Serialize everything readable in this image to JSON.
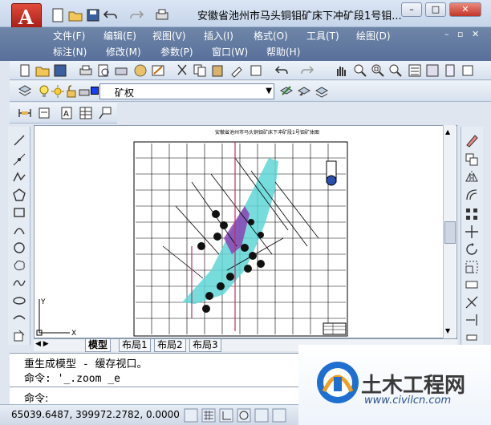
{
  "window": {
    "title": "安徽省池州市马头铜钼矿床下冲矿段1号钼...",
    "minimize": "–",
    "restore": "□",
    "close": "✕"
  },
  "menus": {
    "row1": [
      "文件(F)",
      "编辑(E)",
      "视图(V)",
      "插入(I)",
      "格式(O)",
      "工具(T)",
      "绘图(D)"
    ],
    "row2": [
      "标注(N)",
      "修改(M)",
      "参数(P)",
      "窗口(W)",
      "帮助(H)"
    ]
  },
  "layer": {
    "current": "矿权",
    "color": "#1a3cff"
  },
  "drawing": {
    "header_text": "安徽省池州市马头铜钼矿床下冲矿段1号钼矿体图"
  },
  "tabs": [
    "模型",
    "布局1",
    "布局2",
    "布局3"
  ],
  "command": {
    "line1": "重生成模型 - 缓存视口。",
    "line2": "命令: '_.zoom _e",
    "prompt": "命令:"
  },
  "status": {
    "coords": "65039.6487, 399972.2782, 0.0000"
  },
  "watermark": {
    "name": "土木工程网",
    "url": "www.civilcn.com"
  },
  "ucs": {
    "x_label": "X",
    "y_label": "Y"
  }
}
